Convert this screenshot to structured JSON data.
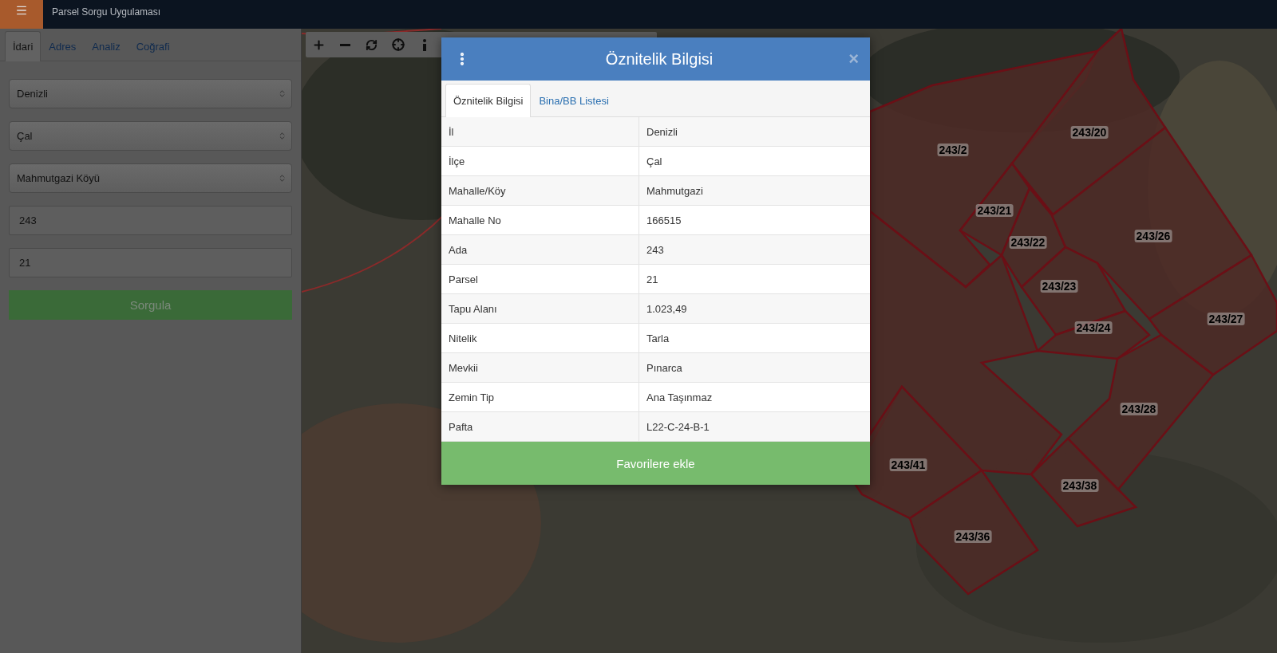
{
  "header": {
    "subtitle": "Parsel Sorgu Uygulaması"
  },
  "sidebar": {
    "tabs": [
      {
        "label": "İdari",
        "selected": true
      },
      {
        "label": "Adres",
        "selected": false
      },
      {
        "label": "Analiz",
        "selected": false
      },
      {
        "label": "Coğrafi",
        "selected": false
      }
    ],
    "fields": [
      {
        "kind": "select",
        "value": "Denizli"
      },
      {
        "kind": "select",
        "value": "Çal"
      },
      {
        "kind": "select",
        "value": "Mahmutgazi Köyü"
      },
      {
        "kind": "input",
        "value": "243"
      },
      {
        "kind": "input",
        "value": "21"
      }
    ],
    "submit": "Sorgula"
  },
  "map": {
    "parcel_labels": [
      "243/2",
      "243/20",
      "243/21",
      "243/22",
      "243/26",
      "243/23",
      "243/24",
      "243/27",
      "243/28",
      "243/41",
      "243/38",
      "243/36"
    ]
  },
  "dialog": {
    "title": "Öznitelik Bilgisi",
    "close": "×",
    "tabs": [
      {
        "label": "Öznitelik Bilgisi",
        "selected": true
      },
      {
        "label": "Bina/BB Listesi",
        "selected": false
      }
    ],
    "rows": [
      {
        "label": "İl",
        "value": "Denizli"
      },
      {
        "label": "İlçe",
        "value": "Çal"
      },
      {
        "label": "Mahalle/Köy",
        "value": "Mahmutgazi"
      },
      {
        "label": "Mahalle No",
        "value": "166515"
      },
      {
        "label": "Ada",
        "value": "243"
      },
      {
        "label": "Parsel",
        "value": "21"
      },
      {
        "label": "Tapu Alanı",
        "value": "1.023,49"
      },
      {
        "label": "Nitelik",
        "value": "Tarla"
      },
      {
        "label": "Mevkii",
        "value": "Pınarca"
      },
      {
        "label": "Zemin Tip",
        "value": "Ana Taşınmaz"
      },
      {
        "label": "Pafta",
        "value": "L22-C-24-B-1"
      }
    ],
    "action": "Favorilere ekle"
  }
}
